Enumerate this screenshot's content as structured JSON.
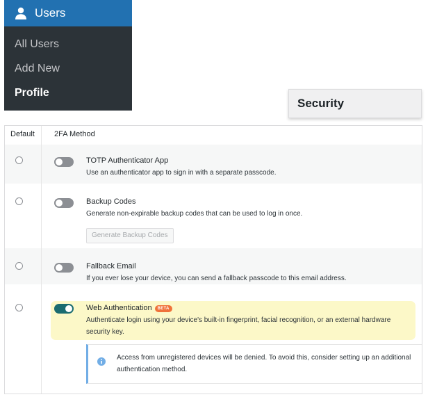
{
  "menu": {
    "title": "Users",
    "items": [
      {
        "label": "All Users"
      },
      {
        "label": "Add New"
      },
      {
        "label": "Profile"
      }
    ]
  },
  "security_tab": {
    "label": "Security"
  },
  "table": {
    "headers": {
      "default": "Default",
      "method": "2FA Method"
    },
    "methods": [
      {
        "title": "TOTP Authenticator App",
        "description": "Use an authenticator app to sign in with a separate passcode.",
        "enabled": false
      },
      {
        "title": "Backup Codes",
        "description": "Generate non-expirable backup codes that can be used to log in once.",
        "button": "Generate Backup Codes",
        "enabled": false
      },
      {
        "title": "Fallback Email",
        "description": "If you ever lose your device, you can send a fallback passcode to this email address.",
        "enabled": false
      },
      {
        "title": "Web Authentication",
        "badge": "BETA",
        "description": "Authenticate login using your device's built-in fingerprint, facial recognition, or an external hardware security key.",
        "enabled": true,
        "notice": "Access from unregistered devices will be denied. To avoid this, consider setting up an additional authentication method."
      }
    ]
  },
  "colors": {
    "menu_bg": "#2c3338",
    "menu_head": "#2271b1",
    "toggle_on": "#1b6c70",
    "badge": "#f0723a",
    "highlight": "#fcf8c8",
    "notice_border": "#72aee6"
  },
  "icons": {
    "menu": "user-icon",
    "notice": "info-icon"
  }
}
